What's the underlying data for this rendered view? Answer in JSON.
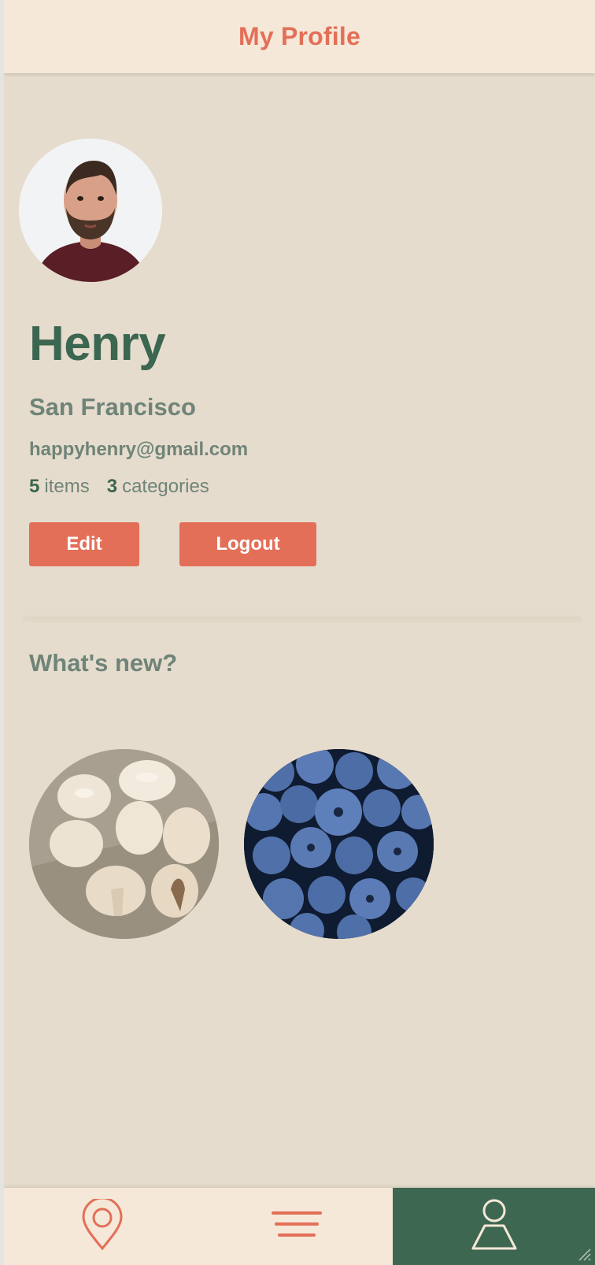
{
  "header": {
    "title": "My Profile"
  },
  "profile": {
    "name": "Henry",
    "city": "San Francisco",
    "email": "happyhenry@gmail.com",
    "items_count": "5",
    "items_label": "items",
    "categories_count": "3",
    "categories_label": "categories"
  },
  "actions": {
    "edit_label": "Edit",
    "logout_label": "Logout"
  },
  "whats_new": {
    "title": "What's new?",
    "items": [
      {
        "icon": "mushrooms-photo"
      },
      {
        "icon": "blueberries-photo"
      }
    ]
  },
  "bottom_nav": {
    "items": [
      {
        "icon": "map-pin-icon",
        "active": false
      },
      {
        "icon": "menu-icon",
        "active": false
      },
      {
        "icon": "profile-icon",
        "active": true
      }
    ]
  },
  "colors": {
    "accent": "#e36f58",
    "primary": "#3e6752",
    "background": "#e6dccd",
    "bar": "#f5e8d8",
    "muted_text": "#6f8478"
  }
}
